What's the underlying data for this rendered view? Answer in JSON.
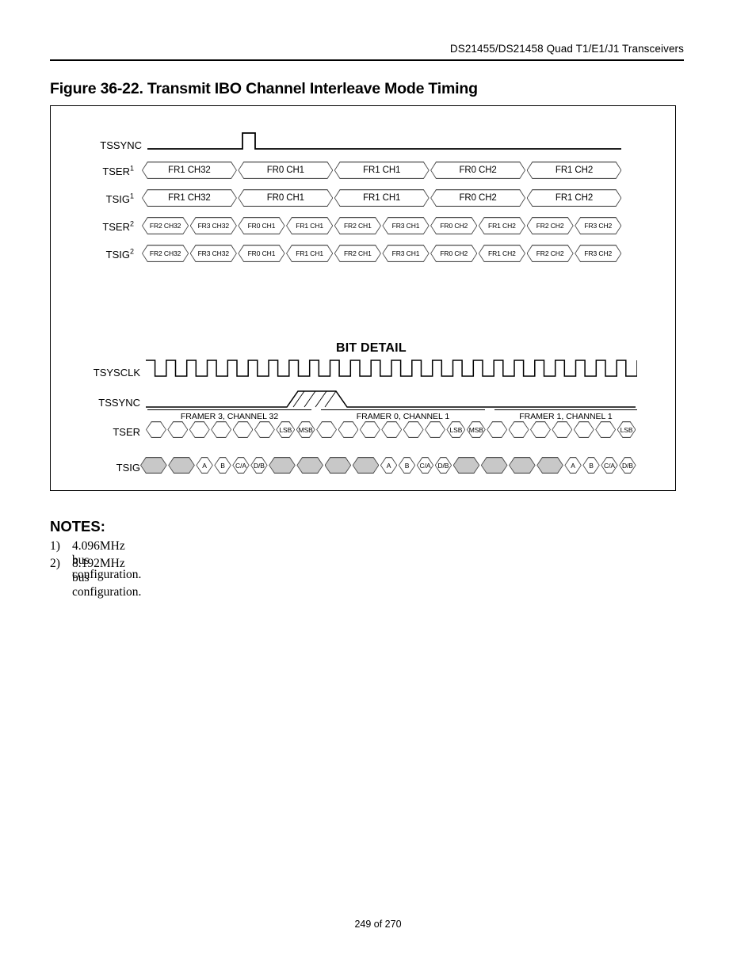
{
  "header": {
    "running_title": "DS21455/DS21458 Quad T1/E1/J1 Transceivers"
  },
  "figure": {
    "title": "Figure 36-22. Transmit IBO Channel Interleave Mode Timing",
    "bit_detail_title": "BIT DETAIL",
    "signals": {
      "tssync": "TSSYNC",
      "tser": "TSER",
      "tsig": "TSIG",
      "tsysclk": "TSYSCLK",
      "note_ref_1": "1",
      "note_ref_2": "2"
    },
    "rows": [
      {
        "label": "TSER",
        "sup": "1",
        "cells": [
          "FR1 CH32",
          "FR0 CH1",
          "FR1 CH1",
          "FR0 CH2",
          "FR1 CH2"
        ]
      },
      {
        "label": "TSIG",
        "sup": "1",
        "cells": [
          "FR1 CH32",
          "FR0 CH1",
          "FR1 CH1",
          "FR0 CH2",
          "FR1 CH2"
        ]
      },
      {
        "label": "TSER",
        "sup": "2",
        "cells": [
          "FR2 CH32",
          "FR3 CH32",
          "FR0 CH1",
          "FR1 CH1",
          "FR2 CH1",
          "FR3 CH1",
          "FR0 CH2",
          "FR1 CH2",
          "FR2 CH2",
          "FR3 CH2"
        ]
      },
      {
        "label": "TSIG",
        "sup": "2",
        "cells": [
          "FR2 CH32",
          "FR3 CH32",
          "FR0 CH1",
          "FR1 CH1",
          "FR2 CH1",
          "FR3 CH1",
          "FR0 CH2",
          "FR1 CH2",
          "FR2 CH2",
          "FR3 CH2"
        ]
      }
    ],
    "bit_detail": {
      "framer_captions": [
        "FRAMER 3, CHANNEL 32",
        "FRAMER 0, CHANNEL 1",
        "FRAMER 1, CHANNEL 1"
      ],
      "tser_group_1": [
        "",
        "",
        "",
        "",
        "",
        "",
        "LSB",
        "MSB"
      ],
      "tser_group_2": [
        "",
        "",
        "",
        "",
        "",
        "",
        "LSB",
        "MSB"
      ],
      "tser_group_3": [
        "",
        "",
        "",
        "",
        "",
        "",
        "LSB"
      ],
      "tsig_group_1": [
        "",
        "",
        "A",
        "B",
        "C/A",
        "D/B"
      ],
      "tsig_group_2": [
        "",
        "",
        "",
        "",
        "A",
        "B",
        "C/A",
        "D/B"
      ],
      "tsig_group_3": [
        "",
        "",
        "",
        "",
        "A",
        "B",
        "C/A",
        "D/B"
      ],
      "clock_cycles": 24
    }
  },
  "notes": {
    "heading": "NOTES:",
    "items": [
      {
        "num": "1)",
        "text": "4.096MHz bus configuration."
      },
      {
        "num": "2)",
        "text": "8.192MHz bus configuration."
      }
    ]
  },
  "footer": {
    "page": "249 of 270"
  }
}
